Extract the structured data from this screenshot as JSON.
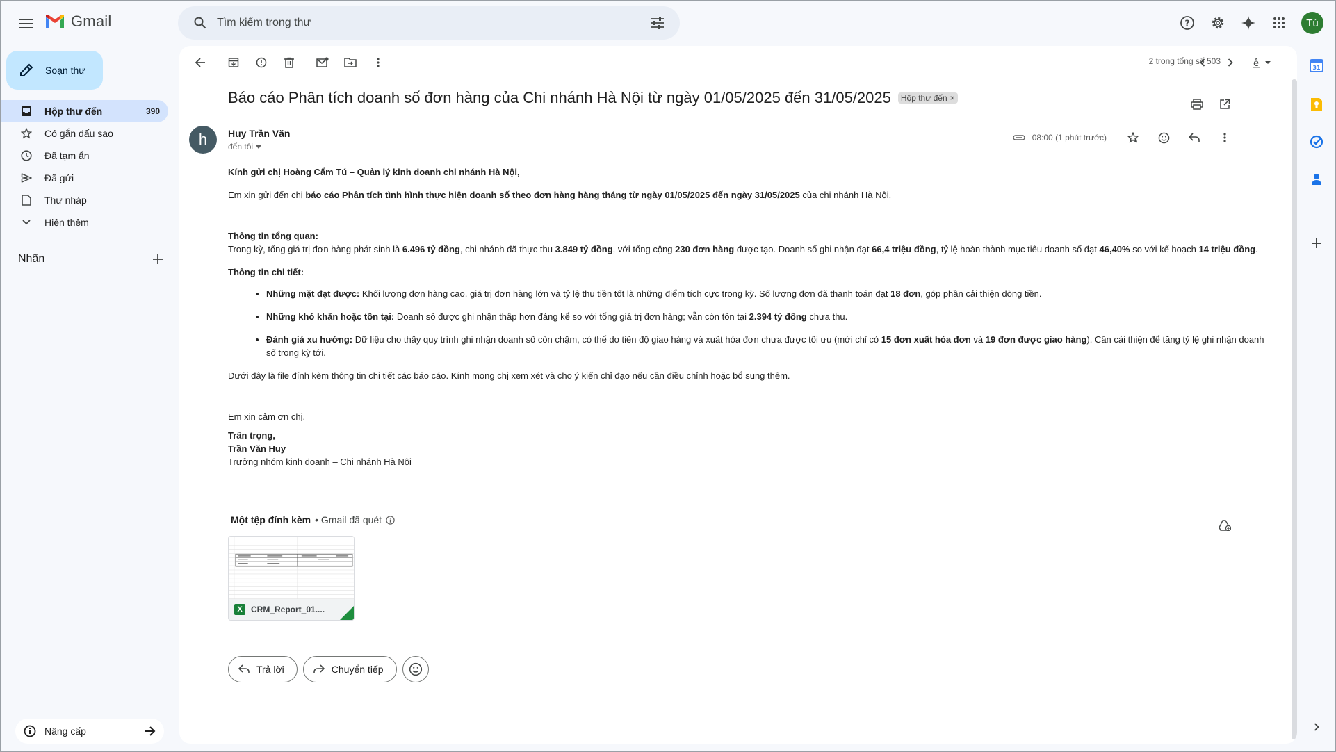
{
  "app": {
    "name": "Gmail",
    "search_placeholder": "Tìm kiếm trong thư",
    "avatar_initials": "Tú"
  },
  "sidebar": {
    "compose_label": "Soạn thư",
    "items": [
      {
        "label": "Hộp thư đến",
        "count": "390",
        "icon": "inbox-icon"
      },
      {
        "label": "Có gắn dấu sao",
        "icon": "star-icon"
      },
      {
        "label": "Đã tạm ẩn",
        "icon": "clock-icon"
      },
      {
        "label": "Đã gửi",
        "icon": "send-icon"
      },
      {
        "label": "Thư nháp",
        "icon": "draft-icon"
      },
      {
        "label": "Hiện thêm",
        "icon": "chevron-down-icon"
      }
    ],
    "labels_heading": "Nhãn",
    "upgrade_label": "Nâng cấp"
  },
  "toolbar": {
    "pager": "2 trong tổng số 503"
  },
  "email": {
    "subject": "Báo cáo Phân tích doanh số đơn hàng của Chi nhánh Hà Nội từ ngày 01/05/2025 đến 31/05/2025",
    "tag": "Hộp thư đến",
    "sender_initial": "h",
    "sender_name": "Huy Trần Văn",
    "to": "đến tôi",
    "time": "08:00 (1 phút trước)",
    "body": {
      "greeting": "Kính gửi chị Hoàng Cẩm Tú – Quản lý kinh doanh chi nhánh Hà Nội,",
      "intro_pre": "Em xin gửi đến chị ",
      "intro_bold": "báo cáo Phân tích tình hình thực hiện doanh số theo đơn hàng hàng tháng từ ngày 01/05/2025 đến ngày 31/05/2025",
      "intro_post": " của chi nhánh Hà Nội.",
      "overview_title": "Thông tin tổng quan:",
      "overview": [
        {
          "t": "Trong kỳ, tổng giá trị đơn hàng phát sinh là "
        },
        {
          "t": "6.496 tỷ đồng",
          "b": true
        },
        {
          "t": ", chi nhánh đã thực thu "
        },
        {
          "t": "3.849 tỷ đồng",
          "b": true
        },
        {
          "t": ", với tổng cộng "
        },
        {
          "t": "230 đơn hàng",
          "b": true
        },
        {
          "t": " được tạo. Doanh số ghi nhận đạt "
        },
        {
          "t": "66,4 triệu đồng",
          "b": true
        },
        {
          "t": ", tỷ lệ hoàn thành mục tiêu doanh số đạt "
        },
        {
          "t": "46,40%",
          "b": true
        },
        {
          "t": " so với kế hoạch "
        },
        {
          "t": "14 triệu đồng",
          "b": true
        },
        {
          "t": "."
        }
      ],
      "details_title": "Thông tin chi tiết:",
      "bullets": [
        [
          {
            "t": "Những mặt đạt được:",
            "b": true
          },
          {
            "t": " Khối lượng đơn hàng cao, giá trị đơn hàng lớn và tỷ lệ thu tiền tốt là những điểm tích cực trong kỳ. Số lượng đơn đã thanh toán đạt "
          },
          {
            "t": "18 đơn",
            "b": true
          },
          {
            "t": ", góp phần cải thiện dòng tiền."
          }
        ],
        [
          {
            "t": "Những khó khăn hoặc tồn tại:",
            "b": true
          },
          {
            "t": " Doanh số được ghi nhận thấp hơn đáng kể so với tổng giá trị đơn hàng; vẫn còn tồn tại "
          },
          {
            "t": "2.394 tỷ đồng",
            "b": true
          },
          {
            "t": " chưa thu."
          }
        ],
        [
          {
            "t": "Đánh giá xu hướng:",
            "b": true
          },
          {
            "t": " Dữ liệu cho thấy quy trình ghi nhận doanh số còn chậm, có thể do tiến độ giao hàng và xuất hóa đơn chưa được tối ưu (mới chỉ có "
          },
          {
            "t": "15 đơn xuất hóa đơn",
            "b": true
          },
          {
            "t": " và "
          },
          {
            "t": "19 đơn được giao hàng",
            "b": true
          },
          {
            "t": "). Cần cải thiện để tăng tỷ lệ ghi nhận doanh số trong kỳ tới."
          }
        ]
      ],
      "closing_note": "Dưới đây là file đính kèm thông tin chi tiết các báo cáo. Kính mong chị xem xét và cho ý kiến chỉ đạo nếu cần điều chỉnh hoặc bổ sung thêm.",
      "thanks": "Em xin cảm ơn chị.",
      "sign_off": "Trân trọng,",
      "sign_name": "Trần Văn Huy",
      "sign_title": "Trưởng nhóm kinh doanh – Chi nhánh Hà Nội"
    },
    "attachments": {
      "heading": "Một tệp đính kèm",
      "scan_note": "• Gmail đã quét",
      "file_name": "CRM_Report_01...."
    },
    "reply_label": "Trả lời",
    "forward_label": "Chuyển tiếp"
  }
}
